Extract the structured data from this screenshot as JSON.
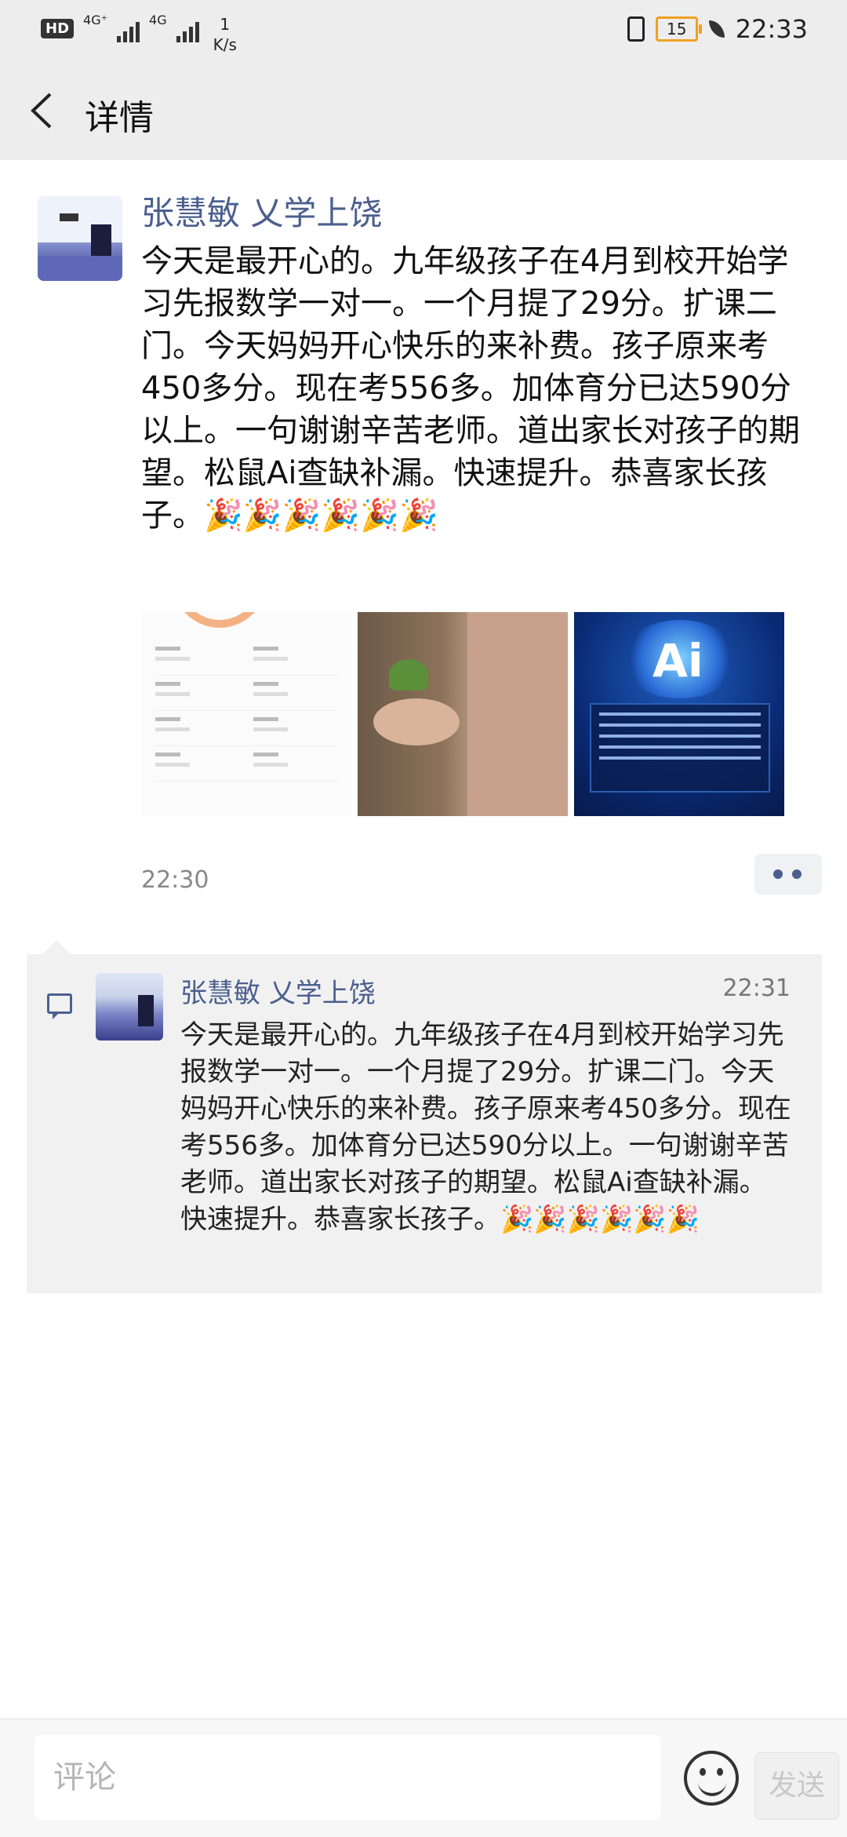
{
  "status_bar": {
    "hd": "HD",
    "network1": "4G⁺",
    "network2": "4G",
    "rate_value": "1",
    "rate_unit": "K/s",
    "battery": "15",
    "time": "22:33"
  },
  "header": {
    "title": "详情"
  },
  "post": {
    "author": "张慧敏 乂学上饶",
    "text": "今天是最开心的。九年级孩子在4月到校开始学习先报数学一对一。一个月提了29分。扩课二门。今天妈妈开心快乐的来补费。孩子原来考450多分。现在考556多。加体育分已达590分以上。一句谢谢辛苦老师。道出家长对孩子的期望。松鼠Ai查缺补漏。快速提升。恭喜家长孩子。",
    "emojis": "🎉🎉🎉🎉🎉🎉",
    "time": "22:30"
  },
  "comment": {
    "author": "张慧敏 乂学上饶",
    "time": "22:31",
    "text": "今天是最开心的。九年级孩子在4月到校开始学习先报数学一对一。一个月提了29分。扩课二门。今天妈妈开心快乐的来补费。孩子原来考450多分。现在考556多。加体育分已达590分以上。一句谢谢辛苦老师。道出家长对孩子的期望。松鼠Ai查缺补漏。快速提升。恭喜家长孩子。",
    "emojis": "🎉🎉🎉🎉🎉🎉"
  },
  "bottom": {
    "comment_placeholder": "评论",
    "send_label": "发送"
  },
  "colors": {
    "name_blue": "#4b5f8f",
    "background_gray": "#ededed",
    "battery_orange": "#f0a020"
  },
  "icons": [
    "back-icon",
    "more-icon",
    "comment-icon",
    "emoji-icon"
  ]
}
